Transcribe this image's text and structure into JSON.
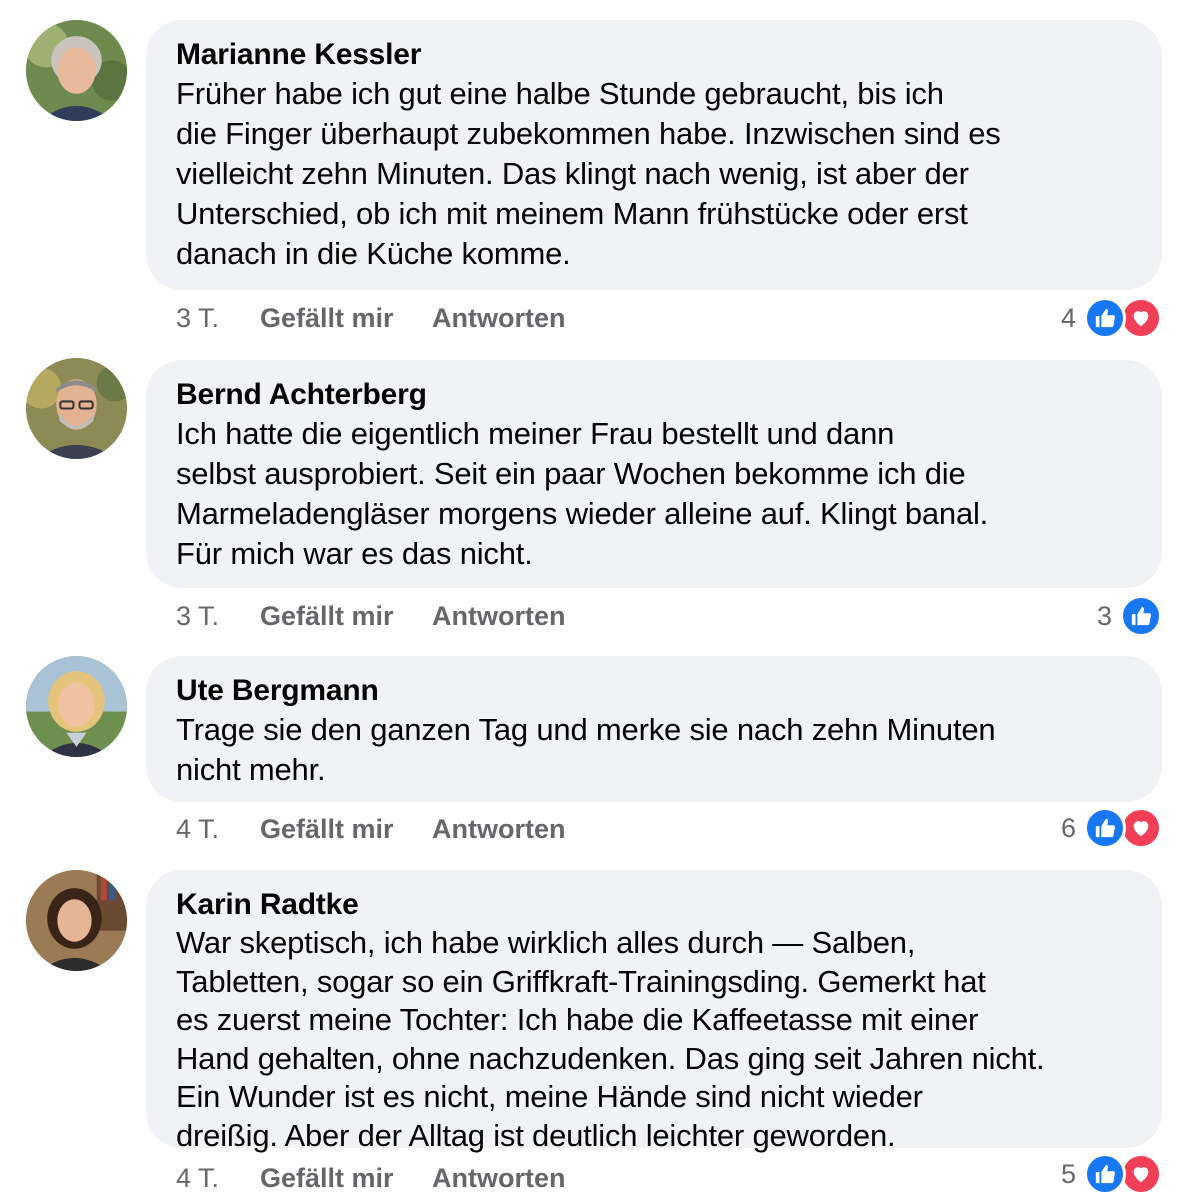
{
  "comments": [
    {
      "author": "Marianne Kessler",
      "text": "Früher habe ich gut eine halbe Stunde gebraucht, bis ich\ndie Finger überhaupt zubekommen habe. Inzwischen sind es\nvielleicht zehn Minuten. Das klingt nach wenig, ist aber der\nUnterschied, ob ich mit meinem Mann frühstücke oder erst\ndanach in die Küche komme.",
      "time": "3 T.",
      "like_label": "Gefällt mir",
      "reply_label": "Antworten",
      "reaction_count": "4",
      "reactions": [
        "like-icon",
        "love-icon"
      ]
    },
    {
      "author": "Bernd Achterberg",
      "text": "Ich hatte die eigentlich meiner Frau bestellt und dann\nselbst ausprobiert. Seit ein paar Wochen bekomme ich die\nMarmeladengläser morgens wieder alleine auf. Klingt banal.\nFür mich war es das nicht.",
      "time": "3 T.",
      "like_label": "Gefällt mir",
      "reply_label": "Antworten",
      "reaction_count": "3",
      "reactions": [
        "like-icon"
      ]
    },
    {
      "author": "Ute Bergmann",
      "text": "Trage sie den ganzen Tag und merke sie nach zehn Minuten\nnicht mehr.",
      "time": "4 T.",
      "like_label": "Gefällt mir",
      "reply_label": "Antworten",
      "reaction_count": "6",
      "reactions": [
        "like-icon",
        "love-icon"
      ]
    },
    {
      "author": "Karin Radtke",
      "text": "War skeptisch, ich habe wirklich alles durch — Salben,\nTabletten, sogar so ein Griffkraft-Trainingsding. Gemerkt hat\nes zuerst meine Tochter: Ich habe die Kaffeetasse mit einer\nHand gehalten, ohne nachzudenken. Das ging seit Jahren nicht.\nEin Wunder ist es nicht, meine Hände sind nicht wieder\ndreißig. Aber der Alltag ist deutlich leichter geworden.",
      "time": "4 T.",
      "like_label": "Gefällt mir",
      "reply_label": "Antworten",
      "reaction_count": "5",
      "reactions": [
        "like-icon",
        "love-icon"
      ]
    }
  ],
  "colors": {
    "bubble": "#f0f2f5",
    "meta_text": "#65676b",
    "like_blue": "#1877f2",
    "love_red": "#f33e58"
  }
}
